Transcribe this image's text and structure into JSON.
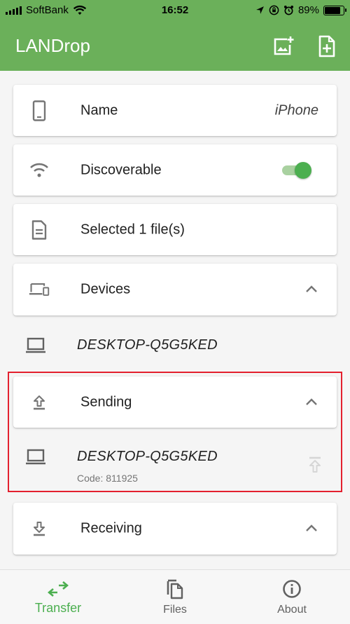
{
  "status_bar": {
    "carrier": "SoftBank",
    "time": "16:52",
    "battery": "89%"
  },
  "app_bar": {
    "title": "LANDrop",
    "actions": [
      "add-photo-icon",
      "add-file-icon"
    ]
  },
  "settings": {
    "name_label": "Name",
    "name_value": "iPhone",
    "discoverable_label": "Discoverable",
    "discoverable_on": true,
    "selected_label": "Selected 1 file(s)"
  },
  "devices": {
    "label": "Devices",
    "items": [
      {
        "name": "DESKTOP-Q5G5KED"
      }
    ]
  },
  "sending": {
    "label": "Sending",
    "items": [
      {
        "name": "DESKTOP-Q5G5KED",
        "code": "Code: 811925"
      }
    ]
  },
  "receiving": {
    "label": "Receiving"
  },
  "bottom_nav": {
    "items": [
      {
        "label": "Transfer",
        "icon": "swap-horiz-icon",
        "active": true
      },
      {
        "label": "Files",
        "icon": "file-copy-icon",
        "active": false
      },
      {
        "label": "About",
        "icon": "info-icon",
        "active": false
      }
    ]
  },
  "colors": {
    "primary": "#6bb05a",
    "accent": "#4caf50",
    "highlight_border": "#e3202e"
  }
}
